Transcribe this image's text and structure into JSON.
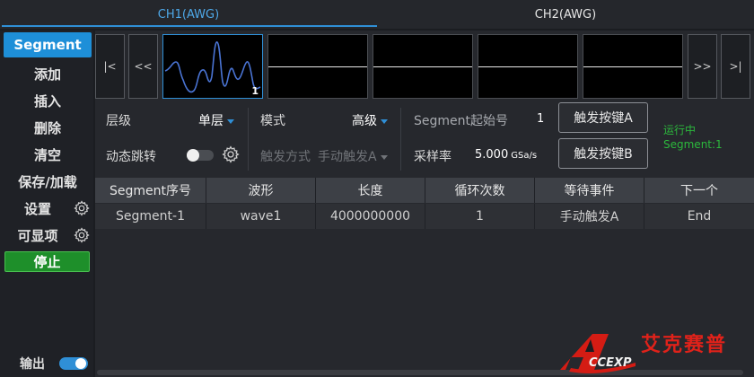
{
  "tabs": [
    {
      "label": "CH1(AWG)",
      "active": true
    },
    {
      "label": "CH2(AWG)",
      "active": false
    }
  ],
  "sidebar": {
    "items": [
      {
        "label": "Segment",
        "active": true
      },
      {
        "label": "添加"
      },
      {
        "label": "插入"
      },
      {
        "label": "删除"
      },
      {
        "label": "清空"
      },
      {
        "label": "保存/加载"
      },
      {
        "label": "设置",
        "icon": "gear-icon"
      },
      {
        "label": "可显项",
        "icon": "gear-icon"
      }
    ],
    "stop_label": "停止",
    "output_label": "输出",
    "output_on": true
  },
  "segment_nav": {
    "first_label": "|<",
    "prev_label": "<<",
    "next_label": ">>",
    "last_label": ">|",
    "selected_thumb_number": "1"
  },
  "params": {
    "level_label": "层级",
    "level_value": "单层",
    "mode_label": "模式",
    "mode_value": "高级",
    "seg_start_label": "Segment起始号",
    "seg_start_value": "1",
    "trigger_a_label": "触发按键A",
    "trigger_b_label": "触发按键B",
    "dynamic_jump_label": "动态跳转",
    "dynamic_jump_on": false,
    "trigger_mode_label": "触发方式",
    "trigger_mode_value": "手动触发A",
    "sample_rate_label": "采样率",
    "sample_rate_value": "5.000",
    "sample_rate_unit": "GSa/s",
    "status_running": "运行中",
    "status_segment": "Segment:1"
  },
  "table": {
    "headers": [
      "Segment序号",
      "波形",
      "长度",
      "循环次数",
      "等待事件",
      "下一个"
    ],
    "rows": [
      [
        "Segment-1",
        "wave1",
        "4000000000",
        "1",
        "手动触发A",
        "End"
      ]
    ]
  },
  "logo": {
    "cn_text": "艾克赛普",
    "en_text": "CCEXP"
  },
  "colors": {
    "accent": "#2f8fd6",
    "stop": "#1e8f2a",
    "status": "#2cb83c",
    "logo_red": "#e0221a"
  }
}
